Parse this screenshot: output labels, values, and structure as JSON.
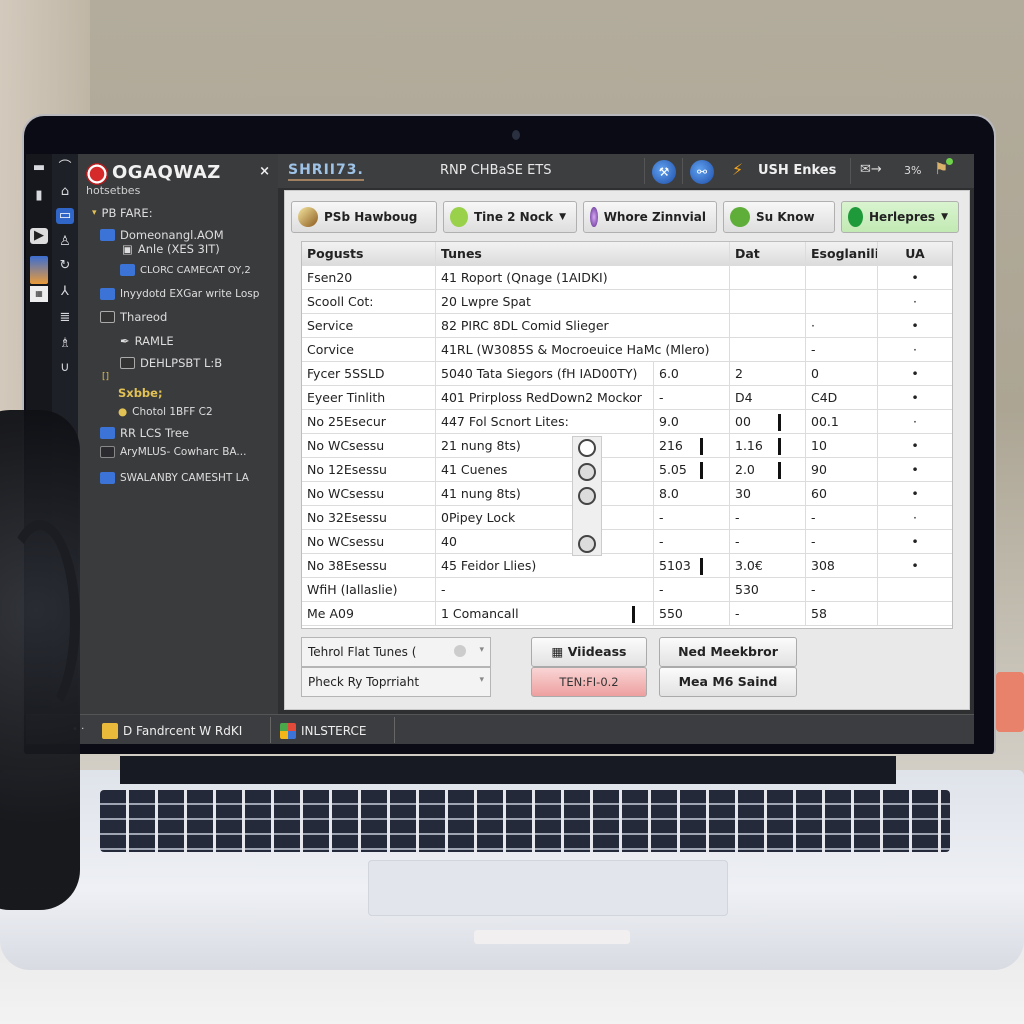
{
  "app": {
    "brand_name": "OGAQWAZ",
    "brand_subtitle": "hotsetbes",
    "close_glyph": "×"
  },
  "colors": {
    "accent_blue": "#3b74d6",
    "folder_yellow": "#e2c155",
    "bolt_orange": "#f2a51a",
    "highlight_green": "#c2e9b3",
    "alert_red": "#ee9f9f"
  },
  "rail_icons": [
    "menu-icon",
    "slider-icon",
    "image-icon",
    "document-icon",
    "grid-icon"
  ],
  "rail2_icons": [
    "wifi-icon",
    "printer-icon",
    "window-icon",
    "user-icon",
    "sync-icon",
    "person-icon",
    "list-icon",
    "robot-icon",
    "magnet-icon"
  ],
  "tree": {
    "items": [
      {
        "label": "PB FARE:",
        "icon": "chevron",
        "level": 0
      },
      {
        "label": "Domeonangl.AOM",
        "icon": "folder",
        "level": 1
      },
      {
        "label": "Anle (XES 3IT)",
        "icon": "window",
        "level": 1
      },
      {
        "label": "CLORC CAMECAT OY,2",
        "icon": "folder",
        "level": 2
      },
      {
        "label": "Inyydotd EXGar write Losp",
        "icon": "folder",
        "level": 0
      },
      {
        "label": "Thareod",
        "icon": "image",
        "level": 0
      },
      {
        "label": "RAMLE",
        "icon": "quill",
        "level": 2
      },
      {
        "label": "DEHLPSBT L:B",
        "icon": "image",
        "level": 2
      },
      {
        "label": "[]",
        "icon": "none",
        "level": 0
      },
      {
        "label": "Sxbbe;",
        "icon": "none",
        "level": 0
      },
      {
        "label": "Chotol 1BFF C2",
        "icon": "dot",
        "level": 0
      },
      {
        "label": "RR LCS Tree",
        "icon": "folder",
        "level": 0
      },
      {
        "label": "AryMLUS- Cowharc BA...",
        "icon": "terminal",
        "level": 0
      },
      {
        "label": "SWALANBY CAMESHT LA",
        "icon": "folder",
        "level": 0
      }
    ]
  },
  "titlebar": {
    "left_label": "SHRII73.",
    "title": "RNP CHBaSE ETS",
    "usb_label": "USH Enkes",
    "mail_label": "→",
    "percent": "3%"
  },
  "toolbar": [
    {
      "label": "PSb Hawboug",
      "icon": "wand-icon",
      "caret": false,
      "green": false
    },
    {
      "label": "Tine 2 Nock",
      "icon": "badge-icon",
      "caret": true,
      "green": false
    },
    {
      "label": "Whore Zinnvial",
      "icon": "pinwheel-icon",
      "caret": false,
      "green": false
    },
    {
      "label": "Su Know",
      "icon": "frog-icon",
      "caret": false,
      "green": false
    },
    {
      "label": "Herlepres",
      "icon": "leaf-icon",
      "caret": true,
      "green": true
    }
  ],
  "table": {
    "columns": [
      "Pogusts",
      "Tunes",
      "Dat",
      "Esoglanili",
      "UA"
    ],
    "rows": [
      [
        "Fsen20",
        "41 Roport (Qnage (1AIDKI)",
        "",
        "",
        "",
        "•"
      ],
      [
        "Scooll Cot:",
        "20 Lwpre Spat",
        "",
        "",
        "",
        "·"
      ],
      [
        "Service",
        "82 PIRC 8DL Comid Slieger",
        "",
        "",
        "·",
        "•"
      ],
      [
        "Corvice",
        "41RL (W3085S & Mocroeuice HaMc (Mlero)",
        "",
        "",
        "-",
        "·"
      ],
      [
        "Fycer 5SSLD",
        "5040 Tata Siegors (fH IAD00TY)",
        "6.0",
        "2",
        "0",
        "•"
      ],
      [
        "Eyeer Tinlith",
        "401 Prirploss RedDown2 Mockor",
        "-",
        "D4",
        "C4D",
        "•"
      ],
      [
        "No 25Esecur",
        "447 Fol Scnort Lites:",
        "9.0",
        "00",
        "00.1",
        "·"
      ],
      [
        "No WCsessu",
        "21 nung 8ts)",
        "216",
        "1.16",
        "10",
        "•"
      ],
      [
        "No 12Esessu",
        "41 Cuenes",
        "5.05",
        "2.0",
        "90",
        "•"
      ],
      [
        "No WCsessu",
        "41 nung 8ts)",
        "8.0",
        "30",
        "60",
        "•"
      ],
      [
        "No 32Esessu",
        "0Pipey Lock",
        "-",
        "-",
        "-",
        "·"
      ],
      [
        "No WCsessu",
        "40",
        "-",
        "-",
        "-",
        "•"
      ],
      [
        "No 38Esessu",
        "45 Feidor Llies)",
        "5103",
        "3.0€",
        "308",
        "•"
      ],
      [
        "WfiH (Iallaslie)",
        "-",
        "-",
        "530",
        "-",
        ""
      ],
      [
        "Me A09",
        "1 Comancall",
        "550",
        "-",
        "58",
        ""
      ]
    ]
  },
  "bottom": {
    "combo1": "Tehrol Flat Tunes (",
    "combo2": "Pheck Ry Toprriaht",
    "btn_videos": "Viideass",
    "btn_tension": "TEN:FI-0.2",
    "btn_need": "Ned Meekbror",
    "btn_mea": "Mea M6 Saind"
  },
  "taskbar": {
    "item1": "D Fandrcent W RdKI",
    "item2": "INLSTERCE"
  }
}
